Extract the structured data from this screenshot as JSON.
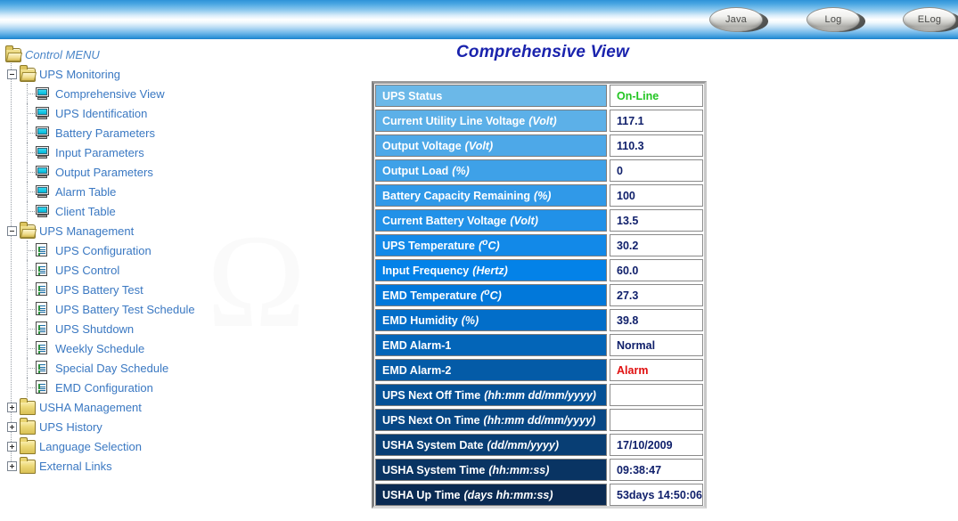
{
  "header": {
    "buttons": [
      {
        "name": "java-button",
        "label": "Java"
      },
      {
        "name": "log-button",
        "label": "Log"
      },
      {
        "name": "elog-button",
        "label": "ELog"
      }
    ]
  },
  "sidebar": {
    "items": [
      {
        "label": "Control MENU",
        "icon": "folder-open-icon",
        "level": 0,
        "expander": "none",
        "kind": "root"
      },
      {
        "label": "UPS Monitoring",
        "icon": "folder-open-icon",
        "level": 1,
        "expander": "minus",
        "kind": "group"
      },
      {
        "label": "Comprehensive View",
        "icon": "monitor-icon",
        "level": 2,
        "expander": "none",
        "kind": "leaf"
      },
      {
        "label": "UPS Identification",
        "icon": "monitor-icon",
        "level": 2,
        "expander": "none",
        "kind": "leaf"
      },
      {
        "label": "Battery Parameters",
        "icon": "monitor-icon",
        "level": 2,
        "expander": "none",
        "kind": "leaf"
      },
      {
        "label": "Input Parameters",
        "icon": "monitor-icon",
        "level": 2,
        "expander": "none",
        "kind": "leaf"
      },
      {
        "label": "Output Parameters",
        "icon": "monitor-icon",
        "level": 2,
        "expander": "none",
        "kind": "leaf"
      },
      {
        "label": "Alarm Table",
        "icon": "monitor-icon",
        "level": 2,
        "expander": "none",
        "kind": "leaf"
      },
      {
        "label": "Client Table",
        "icon": "monitor-icon",
        "level": 2,
        "expander": "none",
        "kind": "leaf"
      },
      {
        "label": "UPS Management",
        "icon": "folder-open-icon",
        "level": 1,
        "expander": "minus",
        "kind": "group"
      },
      {
        "label": "UPS Configuration",
        "icon": "document-icon",
        "level": 2,
        "expander": "none",
        "kind": "leaf"
      },
      {
        "label": "UPS Control",
        "icon": "document-icon",
        "level": 2,
        "expander": "none",
        "kind": "leaf"
      },
      {
        "label": "UPS Battery Test",
        "icon": "document-icon",
        "level": 2,
        "expander": "none",
        "kind": "leaf"
      },
      {
        "label": "UPS Battery Test Schedule",
        "icon": "document-icon",
        "level": 2,
        "expander": "none",
        "kind": "leaf"
      },
      {
        "label": "UPS Shutdown",
        "icon": "document-icon",
        "level": 2,
        "expander": "none",
        "kind": "leaf"
      },
      {
        "label": "Weekly Schedule",
        "icon": "document-icon",
        "level": 2,
        "expander": "none",
        "kind": "leaf"
      },
      {
        "label": "Special Day Schedule",
        "icon": "document-icon",
        "level": 2,
        "expander": "none",
        "kind": "leaf"
      },
      {
        "label": "EMD Configuration",
        "icon": "document-icon",
        "level": 2,
        "expander": "none",
        "kind": "leaf"
      },
      {
        "label": "USHA Management",
        "icon": "folder-closed-icon",
        "level": 1,
        "expander": "plus",
        "kind": "group"
      },
      {
        "label": "UPS History",
        "icon": "folder-closed-icon",
        "level": 1,
        "expander": "plus",
        "kind": "group"
      },
      {
        "label": "Language Selection",
        "icon": "folder-closed-icon",
        "level": 1,
        "expander": "plus",
        "kind": "group"
      },
      {
        "label": "External Links",
        "icon": "folder-closed-icon",
        "level": 1,
        "expander": "plus",
        "kind": "group"
      }
    ]
  },
  "main": {
    "title": "Comprehensive View",
    "rows": [
      {
        "label": "UPS Status",
        "unit": "",
        "value": "On-Line",
        "value_style": "online"
      },
      {
        "label": "Current Utility Line Voltage",
        "unit": "(Volt)",
        "value": "117.1",
        "value_style": "normal"
      },
      {
        "label": "Output Voltage",
        "unit": "(Volt)",
        "value": "110.3",
        "value_style": "normal"
      },
      {
        "label": "Output Load",
        "unit": "(%)",
        "value": "0",
        "value_style": "normal"
      },
      {
        "label": "Battery Capacity Remaining",
        "unit": "(%)",
        "value": "100",
        "value_style": "normal"
      },
      {
        "label": "Current Battery Voltage",
        "unit": "(Volt)",
        "value": "13.5",
        "value_style": "normal"
      },
      {
        "label": "UPS Temperature",
        "unit": "(ºC)",
        "value": "30.2",
        "value_style": "normal"
      },
      {
        "label": "Input Frequency",
        "unit": "(Hertz)",
        "value": "60.0",
        "value_style": "normal"
      },
      {
        "label": "EMD Temperature",
        "unit": "(ºC)",
        "value": "27.3",
        "value_style": "normal"
      },
      {
        "label": "EMD Humidity",
        "unit": "(%)",
        "value": "39.8",
        "value_style": "normal"
      },
      {
        "label": "EMD Alarm-1",
        "unit": "",
        "value": "Normal",
        "value_style": "normal"
      },
      {
        "label": "EMD Alarm-2",
        "unit": "",
        "value": "Alarm",
        "value_style": "alarm"
      },
      {
        "label": "UPS Next Off Time",
        "unit": "(hh:mm dd/mm/yyyy)",
        "value": "",
        "value_style": "normal"
      },
      {
        "label": "UPS Next On Time",
        "unit": "(hh:mm dd/mm/yyyy)",
        "value": "",
        "value_style": "normal"
      },
      {
        "label": "USHA System Date",
        "unit": "(dd/mm/yyyy)",
        "value": "17/10/2009",
        "value_style": "normal"
      },
      {
        "label": "USHA System Time",
        "unit": "(hh:mm:ss)",
        "value": "09:38:47",
        "value_style": "normal"
      },
      {
        "label": "USHA Up Time",
        "unit": "(days hh:mm:ss)",
        "value": "53days 14:50:06",
        "value_style": "normal"
      }
    ]
  },
  "colors": {
    "label_gradient_top": "#6BB8E8",
    "label_gradient_mid": "#0080E8",
    "label_gradient_bottom": "#0A2A52",
    "title": "#1A23AD",
    "link": "#3A78C2",
    "online": "#22C522",
    "alarm": "#E01010",
    "value": "#10206B"
  }
}
